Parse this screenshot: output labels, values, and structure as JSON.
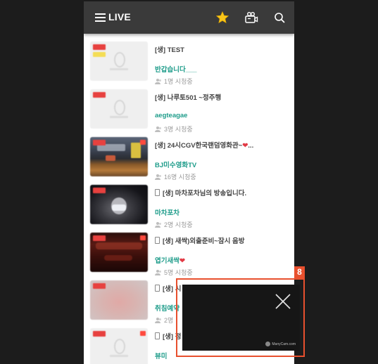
{
  "header": {
    "title": "LIVE",
    "star_color": "#f8c51a",
    "icons": [
      "menu-icon",
      "star-icon",
      "video-camera-icon",
      "search-icon"
    ]
  },
  "colors": {
    "bj_name": "#1e9c8a",
    "popup_border": "#e8502e",
    "topbar": "#3a3a3a"
  },
  "broadcasts": [
    {
      "title": "[생] TEST",
      "bj": "반갑습니다___",
      "viewers": "1명 시청중",
      "mobile": false,
      "heart": false,
      "thumb": "placeholder"
    },
    {
      "title": "[생] 나루토501 ~정주행",
      "bj": "aegteagae",
      "viewers": "3명 시청중",
      "mobile": false,
      "heart": false,
      "thumb": "placeholder"
    },
    {
      "title": "[생] 24시CGV한국랜덤영화관~",
      "bj": "BJ미수영화TV",
      "viewers": "16명 시청중",
      "mobile": false,
      "heart": true,
      "thumb": "cinema"
    },
    {
      "title": "[생] 마차포차님의 방송입니다.",
      "bj": "마차포차",
      "viewers": "2명 시청중",
      "mobile": true,
      "heart": false,
      "thumb": "person"
    },
    {
      "title": "[생] 새싹)외출준비~잠시 음방",
      "bj": "엽기새싹",
      "viewers": "5명 시청중",
      "mobile": true,
      "heart": true,
      "thumb": "dark-red"
    },
    {
      "title": "[생] 시",
      "bj": "취침예약",
      "viewers": "2명",
      "mobile": true,
      "heart": false,
      "thumb": "pink"
    },
    {
      "title": "[생] 정",
      "bj": "뷰미",
      "viewers": "",
      "mobile": true,
      "heart": false,
      "thumb": "placeholder"
    }
  ],
  "popup": {
    "number": "8",
    "brand": "ManyCam.com",
    "close_label": "close"
  }
}
